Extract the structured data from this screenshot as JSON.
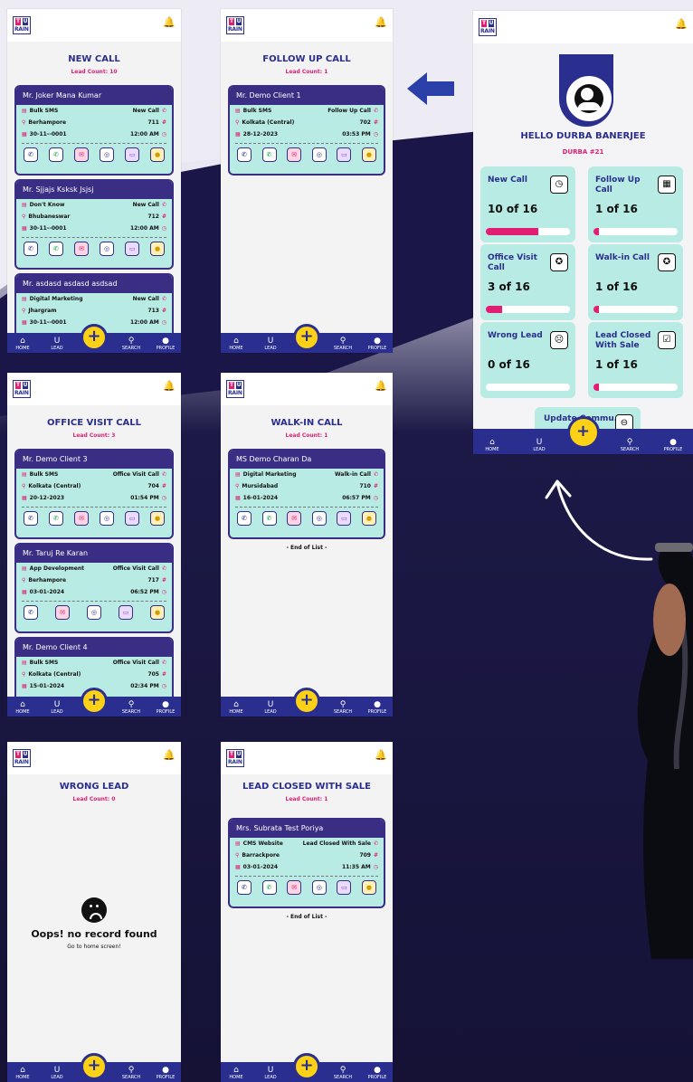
{
  "brand": {
    "logo_text": "TU RAIN"
  },
  "nav": {
    "home": "HOME",
    "lead": "LEAD",
    "search": "SEARCH",
    "profile": "PROFILE"
  },
  "screens": {
    "new_call": {
      "title": "NEW CALL",
      "lead_count": "Lead Count: 10",
      "cards": [
        {
          "name": "Mr. Joker Mana Kumar",
          "source": "Bulk SMS",
          "status": "New Call",
          "location": "Berhampore",
          "id": "711",
          "date": "30-11--0001",
          "time": "12:00 AM"
        },
        {
          "name": "Mr. Sjjajs Ksksk Jsjsj",
          "source": "Don't Know",
          "status": "New Call",
          "location": "Bhubaneswar",
          "id": "712",
          "date": "30-11--0001",
          "time": "12:00 AM"
        },
        {
          "name": "Mr. asdasd asdasd asdsad",
          "source": "Digital Marketing",
          "status": "New Call",
          "location": "Jhargram",
          "id": "713",
          "date": "30-11--0001",
          "time": "12:00 AM"
        }
      ]
    },
    "follow_up": {
      "title": "FOLLOW UP CALL",
      "lead_count": "Lead Count: 1",
      "cards": [
        {
          "name": "Mr. Demo  Client 1",
          "source": "Bulk SMS",
          "status": "Follow Up Call",
          "location": "Kolkata (Central)",
          "id": "702",
          "date": "28-12-2023",
          "time": "03:53 PM"
        }
      ]
    },
    "dashboard": {
      "greeting": "HELLO DURBA BANERJEE",
      "user_tag": "DURBA #21",
      "tiles": [
        {
          "name": "New Call",
          "count": "10 of 16",
          "progress": 0.62,
          "icon": "clock-icon",
          "glyph": "◷"
        },
        {
          "name": "Follow Up Call",
          "count": "1 of 16",
          "progress": 0.06,
          "icon": "calendar-icon",
          "glyph": "▦"
        },
        {
          "name": "Office Visit Call",
          "count": "3 of 16",
          "progress": 0.19,
          "icon": "walk-icon",
          "glyph": "✪"
        },
        {
          "name": "Walk-in Call",
          "count": "1 of 16",
          "progress": 0.06,
          "icon": "walk-icon",
          "glyph": "✪"
        },
        {
          "name": "Wrong Lead",
          "count": "0 of 16",
          "progress": 0.0,
          "icon": "sad-face-icon",
          "glyph": "☹"
        },
        {
          "name": "Lead Closed With Sale",
          "count": "1 of 16",
          "progress": 0.06,
          "icon": "check-icon",
          "glyph": "☑"
        }
      ],
      "update_tile": "Update Commu..."
    },
    "office_visit": {
      "title": "OFFICE VISIT CALL",
      "lead_count": "Lead Count: 3",
      "cards": [
        {
          "name": "Mr. Demo  Client 3",
          "source": "Bulk SMS",
          "status": "Office Visit Call",
          "location": "Kolkata (Central)",
          "id": "704",
          "date": "20-12-2023",
          "time": "01:54 PM"
        },
        {
          "name": "Mr. Taruj Re Karan",
          "source": "App Development",
          "status": "Office Visit Call",
          "location": "Berhampore",
          "id": "717",
          "date": "03-01-2024",
          "time": "06:52 PM"
        },
        {
          "name": "Mr. Demo  Client 4",
          "source": "Bulk SMS",
          "status": "Office Visit Call",
          "location": "Kolkata (Central)",
          "id": "705",
          "date": "15-01-2024",
          "time": "02:34 PM"
        }
      ]
    },
    "walk_in": {
      "title": "WALK-IN CALL",
      "lead_count": "Lead Count: 1",
      "end_of_list": "- End of List -",
      "cards": [
        {
          "name": "MS Demo Charan Da",
          "source": "Digital Marketing",
          "status": "Walk-in Call",
          "location": "Mursidabad",
          "id": "710",
          "date": "16-01-2024",
          "time": "06:57 PM"
        }
      ]
    },
    "wrong_lead": {
      "title": "WRONG LEAD",
      "lead_count": "Lead Count: 0",
      "empty_title": "Oops! no record found",
      "empty_sub": "Go to home screen!"
    },
    "closed_sale": {
      "title": "LEAD CLOSED WITH SALE",
      "lead_count": "Lead Count: 1",
      "end_of_list": "- End of List -",
      "cards": [
        {
          "name": "Mrs. Subrata Test Poriya",
          "source": "CMS Website",
          "status": "Lead Closed With Sale",
          "location": "Barrackpore",
          "id": "709",
          "date": "03-01-2024",
          "time": "11:35 AM"
        }
      ]
    }
  }
}
